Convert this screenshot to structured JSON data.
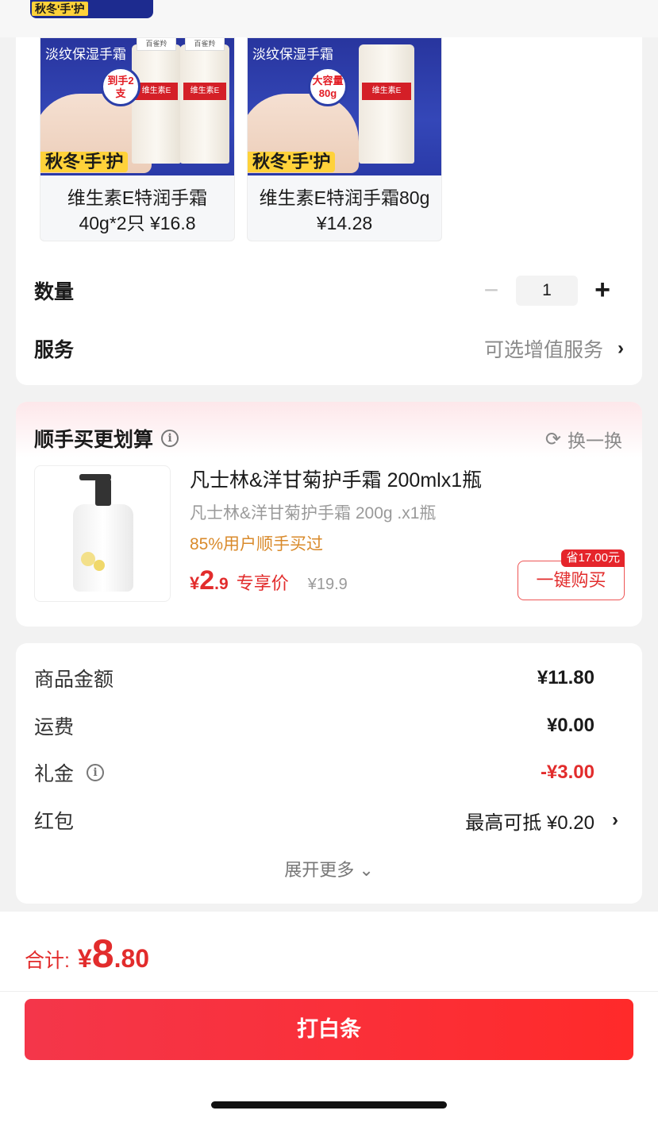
{
  "top_thumb": {
    "tag": "秋冬'手'护"
  },
  "skus": [
    {
      "name": "维生素E特润手霜",
      "line2": "40g*2只 ¥16.8",
      "img_text": "淡纹保湿手霜",
      "badge": "到手2支",
      "tag": "秋冬'手'护",
      "tube_label": "维生素E",
      "brand": "百雀羚"
    },
    {
      "name": "维生素E特润手霜80g",
      "line2": "¥14.28",
      "img_text": "淡纹保湿手霜",
      "badge": "大容量80g",
      "tag": "秋冬'手'护",
      "tube_label": "维生素E"
    }
  ],
  "quantity": {
    "label": "数量",
    "value": "1",
    "minus": "−",
    "plus": "+"
  },
  "service": {
    "label": "服务",
    "value": "可选增值服务",
    "chevron": "›"
  },
  "addon": {
    "title": "顺手买更划算",
    "swap_label": "换一换",
    "product": {
      "title": "凡士林&洋甘菊护手霜 200mlx1瓶",
      "subtitle": "凡士林&洋甘菊护手霜 200g .x1瓶",
      "sold_hint": "85%用户顺手买过",
      "price_currency": "¥",
      "price_int": "2",
      "price_dec": ".9",
      "price_tag": "专享价",
      "original_price": "¥19.9",
      "save_tag": "省17.00元",
      "buy_label": "一键购买"
    }
  },
  "summary": {
    "rows": [
      {
        "label": "商品金额",
        "value": "¥11.80"
      },
      {
        "label": "运费",
        "value": "¥0.00"
      },
      {
        "label": "礼金",
        "value": "-¥3.00"
      },
      {
        "label": "红包",
        "value": "最高可抵 ¥0.20"
      }
    ],
    "expand_label": "展开更多 ⌄"
  },
  "footer": {
    "total_label": "合计:",
    "total_currency": "¥",
    "total_int": "8",
    "total_dec": ".80",
    "pay_label": "打白条"
  },
  "colors": {
    "accent_red": "#e22c2c",
    "pay_gradient_start": "#f4364a",
    "pay_gradient_end": "#ff2a2a",
    "sold_orange": "#d98a2b"
  }
}
